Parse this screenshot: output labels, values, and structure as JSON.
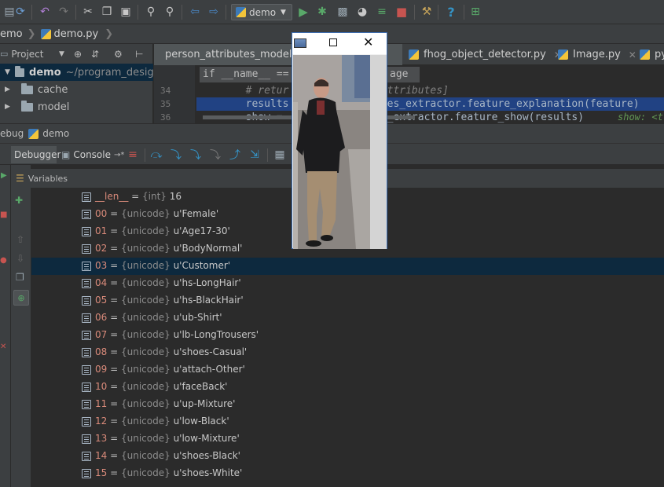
{
  "toolbar": {
    "run_config": "demo"
  },
  "breadcrumb": {
    "project": "emo",
    "file": "demo.py"
  },
  "project_panel": {
    "title": "Project",
    "root_name": "demo",
    "root_path": "~/program_design/te",
    "items": [
      {
        "label": "cache"
      },
      {
        "label": "model"
      }
    ]
  },
  "editor": {
    "tabs": [
      {
        "label": "person_attributes_model."
      },
      {
        "label": "fhog_object_detector.py"
      },
      {
        "label": "Image.py"
      },
      {
        "label": "py"
      }
    ],
    "hint": "if __name__ ==",
    "hint_suffix": "age",
    "lines": [
      {
        "num": "34",
        "text": "        # retur             l_attributes]"
      },
      {
        "num": "35",
        "text": "        results             butes_extractor.feature_explanation(feature)"
      },
      {
        "num": "36",
        "text": "        show =              tes_extractor.feature_show(results)"
      }
    ],
    "inline_hint": "show: <t"
  },
  "debug": {
    "title_prefix": "ebug",
    "title_config": "demo",
    "tabs": {
      "debugger": "Debugger",
      "console": "Console",
      "console_suffix": "→*"
    },
    "variables_label": "Variables",
    "len_row": {
      "name": "__len__",
      "type": "{int}",
      "value": "16"
    },
    "rows": [
      {
        "index": "00",
        "type": "{unicode}",
        "value": "u'Female'"
      },
      {
        "index": "01",
        "type": "{unicode}",
        "value": "u'Age17-30'"
      },
      {
        "index": "02",
        "type": "{unicode}",
        "value": "u'BodyNormal'"
      },
      {
        "index": "03",
        "type": "{unicode}",
        "value": "u'Customer'"
      },
      {
        "index": "04",
        "type": "{unicode}",
        "value": "u'hs-LongHair'"
      },
      {
        "index": "05",
        "type": "{unicode}",
        "value": "u'hs-BlackHair'"
      },
      {
        "index": "06",
        "type": "{unicode}",
        "value": "u'ub-Shirt'"
      },
      {
        "index": "07",
        "type": "{unicode}",
        "value": "u'lb-LongTrousers'"
      },
      {
        "index": "08",
        "type": "{unicode}",
        "value": "u'shoes-Casual'"
      },
      {
        "index": "09",
        "type": "{unicode}",
        "value": "u'attach-Other'"
      },
      {
        "index": "10",
        "type": "{unicode}",
        "value": "u'faceBack'"
      },
      {
        "index": "11",
        "type": "{unicode}",
        "value": "u'up-Mixture'"
      },
      {
        "index": "12",
        "type": "{unicode}",
        "value": "u'low-Black'"
      },
      {
        "index": "13",
        "type": "{unicode}",
        "value": "u'low-Mixture'"
      },
      {
        "index": "14",
        "type": "{unicode}",
        "value": "u'shoes-Black'"
      },
      {
        "index": "15",
        "type": "{unicode}",
        "value": "u'shoes-White'"
      }
    ],
    "selected_index": 3
  },
  "colors": {
    "selection": "#0d293e",
    "editor_selection": "#214283",
    "accent_green": "#499c54",
    "stop_red": "#c75450",
    "help_blue": "#3592c4"
  }
}
